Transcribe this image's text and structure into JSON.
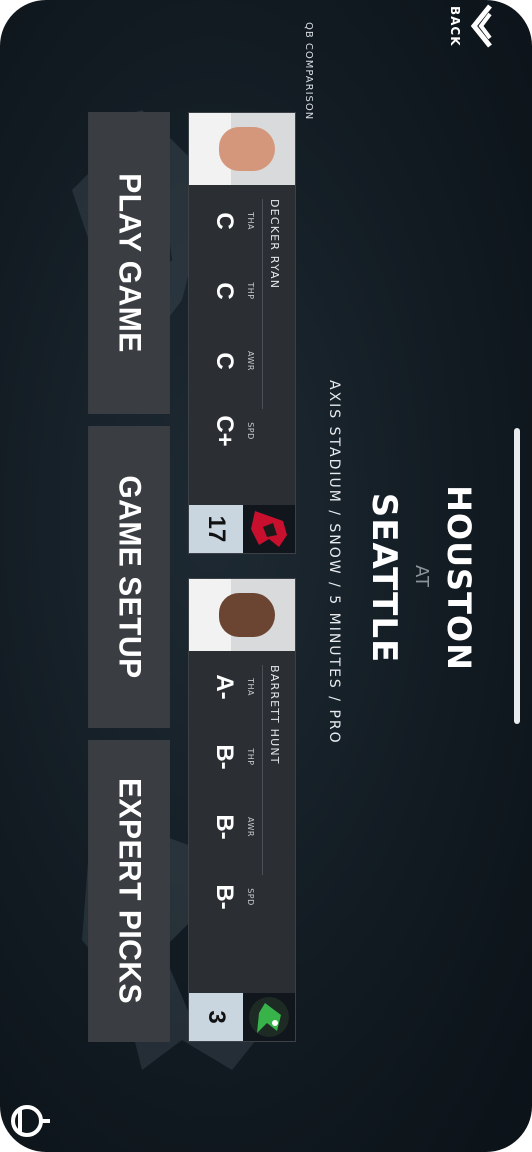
{
  "game": {
    "home_team": "HOUSTON",
    "at": "AT",
    "away_team": "SEATTLE",
    "details": "AXIS STADIUM  /  SNOW  /  5 MINUTES  /  PRO"
  },
  "qb_comparison": {
    "title": "QB COMPARISON",
    "players": [
      {
        "name": "DECKER RYAN",
        "stats": [
          {
            "key": "THA",
            "value": "C"
          },
          {
            "key": "THP",
            "value": "C"
          },
          {
            "key": "AWR",
            "value": "C"
          },
          {
            "key": "SPD",
            "value": "C+"
          }
        ],
        "jersey": "17",
        "team_logo": "houston-logo-icon"
      },
      {
        "name": "BARRETT HUNT",
        "stats": [
          {
            "key": "THA",
            "value": "A-"
          },
          {
            "key": "THP",
            "value": "B-"
          },
          {
            "key": "AWR",
            "value": "B-"
          },
          {
            "key": "SPD",
            "value": "B-"
          }
        ],
        "jersey": "3",
        "team_logo": "seattle-logo-icon"
      }
    ]
  },
  "buttons": {
    "play_game": "PLAY GAME",
    "game_setup": "GAME SETUP",
    "expert_picks": "EXPERT PICKS"
  },
  "nav": {
    "back_label": "BACK",
    "back_icon": "double-chevron-icon",
    "whistle_icon": "whistle-icon"
  },
  "colors": {
    "background": "#121b22",
    "card": "#2b2f34",
    "button": "#3a3d41",
    "jersey_badge": "#c9d6df"
  }
}
